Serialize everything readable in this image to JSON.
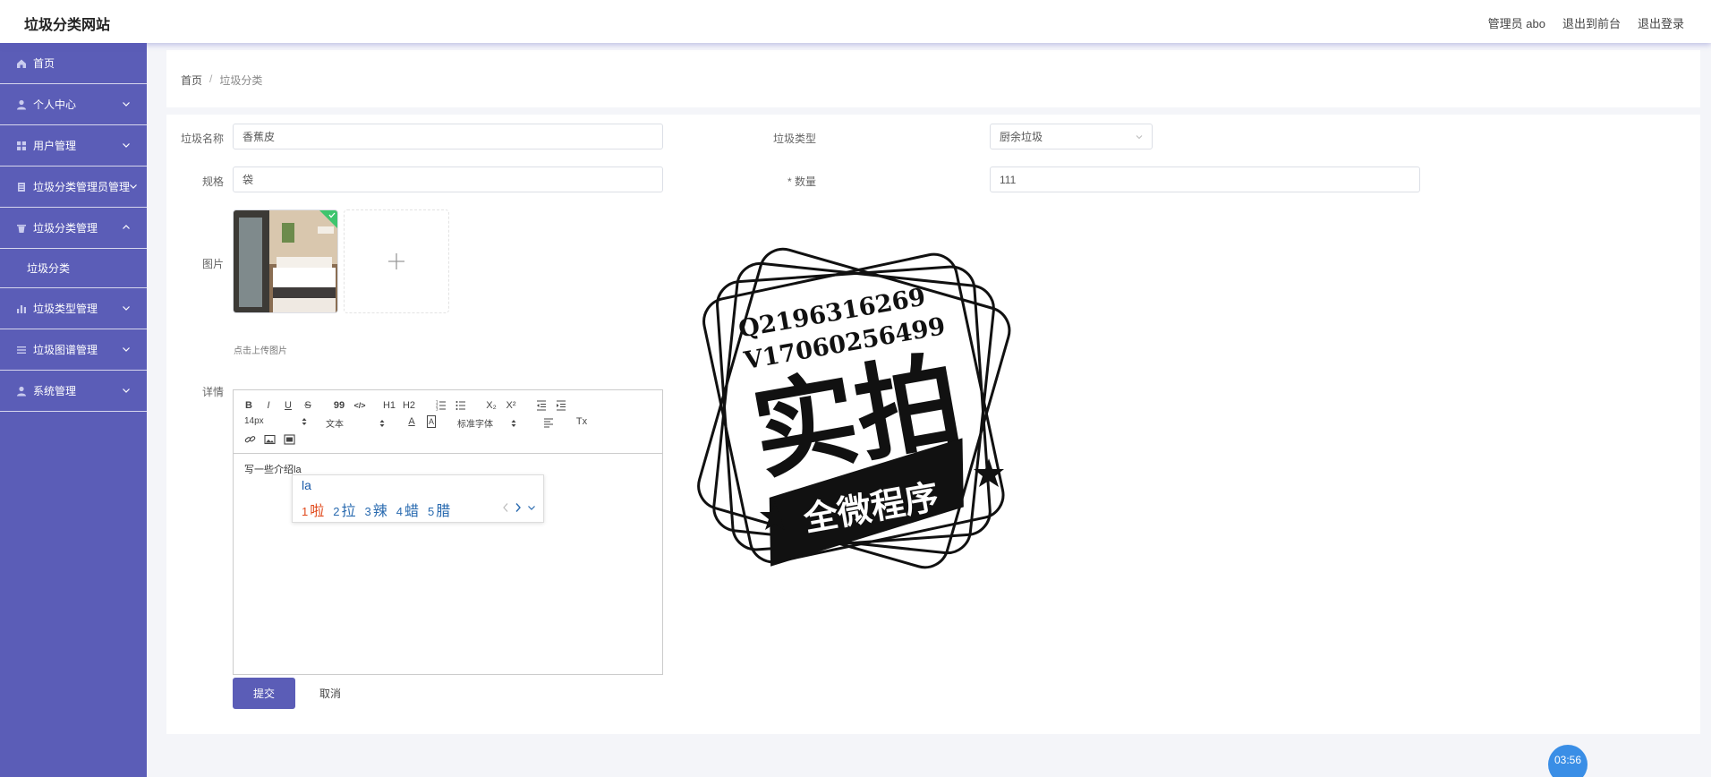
{
  "header": {
    "title": "垃圾分类网站",
    "admin_label": "管理员 abo",
    "back_to_front": "退出到前台",
    "logout": "退出登录"
  },
  "sidebar": {
    "items": [
      {
        "label": "首页",
        "icon": "home-icon"
      },
      {
        "label": "个人中心",
        "icon": "user-icon"
      },
      {
        "label": "用户管理",
        "icon": "grid-icon"
      },
      {
        "label": "垃圾分类管理员管理",
        "icon": "document-icon"
      },
      {
        "label": "垃圾分类管理",
        "icon": "trash-icon"
      },
      {
        "label": "垃圾类型管理",
        "icon": "bar-chart-icon"
      },
      {
        "label": "垃圾图谱管理",
        "icon": "list-icon"
      },
      {
        "label": "系统管理",
        "icon": "user-icon"
      }
    ],
    "submenu": {
      "label": "垃圾分类"
    }
  },
  "breadcrumb": {
    "home": "首页",
    "sep": "/",
    "current": "垃圾分类"
  },
  "form": {
    "name_label": "垃圾名称",
    "name_value": "香蕉皮",
    "type_label": "垃圾类型",
    "type_value": "厨余垃圾",
    "spec_label": "规格",
    "spec_value": "袋",
    "qty_label": "* 数量",
    "qty_value": "111",
    "image_label": "图片",
    "upload_tip": "点击上传图片",
    "detail_label": "详情"
  },
  "editor": {
    "font_size": "14px",
    "block_type": "文本",
    "font_family": "标准字体",
    "content": "写一些介绍la",
    "tools": {
      "bold": "B",
      "italic": "I",
      "underline": "U",
      "strike": "S",
      "quote": "99",
      "code": "</>",
      "h1": "H1",
      "h2": "H2",
      "sub": "X₂",
      "sup": "X²",
      "clean": "Tx",
      "color": "A",
      "bg": "A"
    }
  },
  "ime": {
    "input": "la",
    "candidates": [
      {
        "n": "1",
        "text": "啦"
      },
      {
        "n": "2",
        "text": "拉"
      },
      {
        "n": "3",
        "text": "辣"
      },
      {
        "n": "4",
        "text": "蜡"
      },
      {
        "n": "5",
        "text": "腊"
      }
    ]
  },
  "buttons": {
    "submit": "提交",
    "cancel": "取消"
  },
  "watermark": {
    "line1": "Q2196316269",
    "line2": "V17060256499",
    "big": "实拍",
    "banner": "全微程序"
  },
  "timer": "03:56",
  "colors": {
    "sidebar": "#5b5db7",
    "primary": "#5b5db7",
    "ime_first": "#e0491b",
    "ime_cand": "#2a6bb0"
  }
}
